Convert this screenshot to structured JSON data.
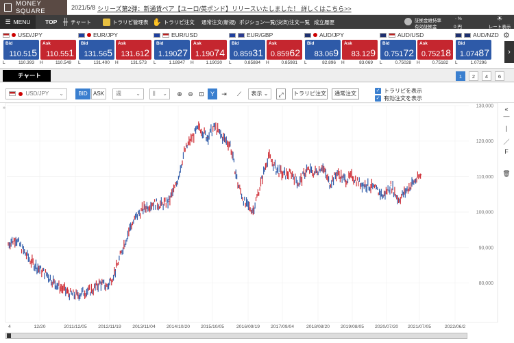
{
  "banner": {
    "logo_text": "MONEY SQUARE",
    "news_date": "2021/5/8",
    "news_text": "シリーズ第2弾：新通貨ペア【ユーロ/英ポンド】リリースいたしました！ 詳しくはこちら>>"
  },
  "nav": {
    "menu": "MENU",
    "top": "TOP",
    "chart": "チャート",
    "trap_manage": "トラリピ管理表",
    "trap_order": "トラリピ注文",
    "normal_order": "通常注文(新規)",
    "positions": "ポジション一覧(決済)",
    "order_list": "注文一覧",
    "history": "成立履歴",
    "margin_rate_label": "証拠金維持率",
    "margin_rate_value": "- %",
    "effective_margin_label": "有効証拠金",
    "effective_margin_value": "0 円",
    "rate_display": "レート表示"
  },
  "rates": [
    {
      "pair": "USD/JPY",
      "bid_main": "110.51",
      "bid_last": "5",
      "ask_main": "110.55",
      "ask_last": "1",
      "low": "110.393",
      "high": "110.549",
      "flag": "us"
    },
    {
      "pair": "EUR/JPY",
      "bid_main": "131.56",
      "bid_last": "5",
      "ask_main": "131.61",
      "ask_last": "2",
      "low": "131.400",
      "high": "131.573",
      "flag": "eu"
    },
    {
      "pair": "EUR/USD",
      "bid_main": "1.190",
      "bid_last": "27",
      "ask_main": "1.190",
      "ask_last": "74",
      "low": "1.18947",
      "high": "1.19030",
      "flag": "eu"
    },
    {
      "pair": "EUR/GBP",
      "bid_main": "0.859",
      "bid_last": "31",
      "ask_main": "0.859",
      "ask_last": "62",
      "low": "0.85884",
      "high": "0.85981",
      "flag": "eu"
    },
    {
      "pair": "AUD/JPY",
      "bid_main": "83.06",
      "bid_last": "9",
      "ask_main": "83.12",
      "ask_last": "9",
      "low": "82.896",
      "high": "83.069",
      "flag": "au"
    },
    {
      "pair": "AUD/USD",
      "bid_main": "0.751",
      "bid_last": "72",
      "ask_main": "0.752",
      "ask_last": "18",
      "low": "0.75028",
      "high": "0.75182",
      "flag": "au"
    },
    {
      "pair": "AUD/NZD",
      "bid_main": "1.074",
      "bid_last": "87",
      "ask_main": "",
      "ask_last": "",
      "low": "1.07296",
      "high": "",
      "flag": "au"
    }
  ],
  "labels": {
    "bid": "Bid",
    "ask": "Ask",
    "low": "L",
    "high": "H"
  },
  "chart_panel": {
    "title": "チャート",
    "tabs": [
      "1",
      "2",
      "4",
      "6"
    ],
    "active_tab": "1"
  },
  "toolbar": {
    "pair": "USD/JPY",
    "bid": "BID",
    "ask": "ASK",
    "timeframe": "週",
    "display": "表示",
    "trap_order": "トラリピ注文",
    "normal_order": "通常注文",
    "show_trap": "トラリピを表示",
    "show_orders": "有効注文を表示"
  },
  "chart_data": {
    "type": "line",
    "title": "",
    "xlabel": "",
    "ylabel": "",
    "ylim": [
      75000,
      130000
    ],
    "y_ticks": [
      "130,000",
      "120,000",
      "110,000",
      "100,000",
      "90,000",
      "80,000"
    ],
    "x_ticks": [
      "4",
      "12/20",
      "2011/12/05",
      "2012/11/19",
      "2013/11/04",
      "2014/10/20",
      "2015/10/05",
      "2016/09/19",
      "2017/09/04",
      "2018/08/20",
      "2019/08/05",
      "2020/07/20",
      "2021/07/05",
      "2022/06/2"
    ],
    "series": [
      {
        "values": [
          91000,
          92500,
          89000,
          86000,
          84000,
          82500,
          80000,
          78500,
          77000,
          76500,
          77500,
          78000,
          80000,
          79000,
          83500,
          90000,
          96000,
          99500,
          101500,
          102500,
          102000,
          103000,
          108000,
          117000,
          121000,
          124000,
          121000,
          124000,
          121000,
          119000,
          108000,
          102000,
          100500,
          108000,
          116000,
          112000,
          110500,
          111000,
          108000,
          112000,
          111000,
          113000,
          108000,
          111000,
          109000,
          110000,
          108000,
          107500,
          106500,
          104500,
          107500,
          103500,
          106000,
          108500,
          110500
        ]
      }
    ]
  }
}
